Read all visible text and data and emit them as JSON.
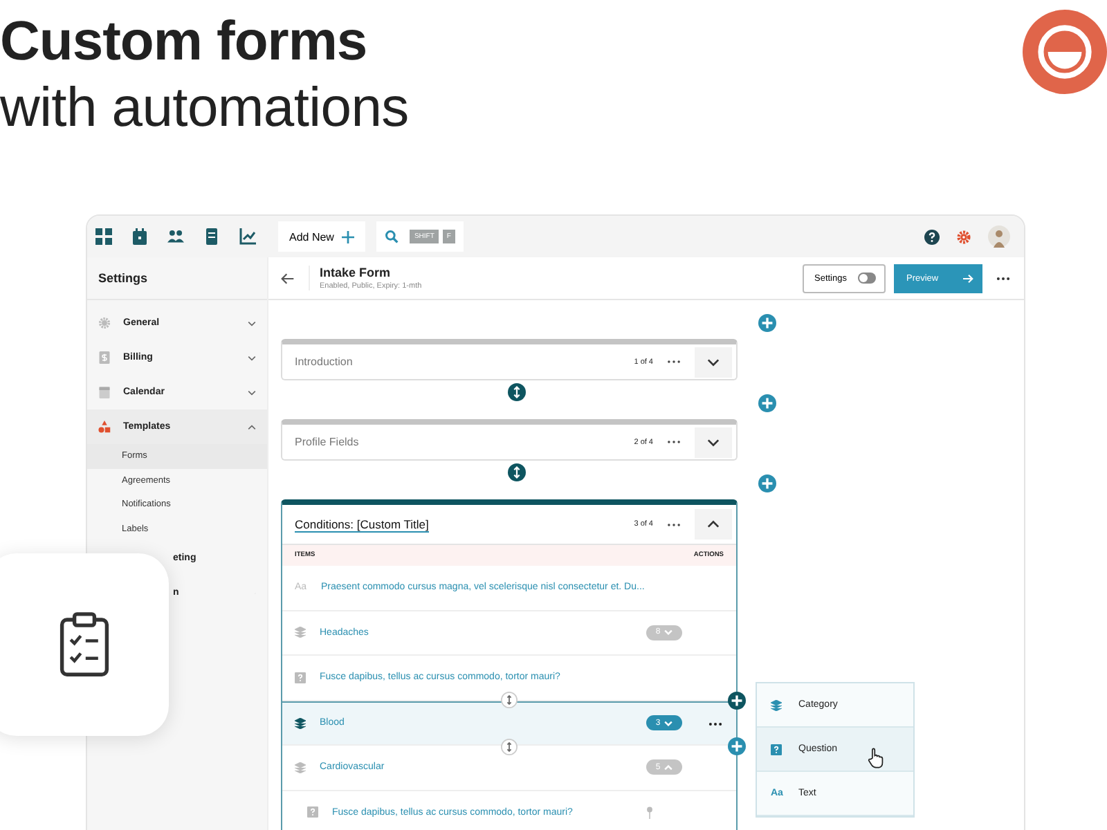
{
  "headline": {
    "title": "Custom forms",
    "subtitle": "with automations"
  },
  "toolbar": {
    "add_new": "Add New",
    "shortcut_keys": [
      "SHIFT",
      "F"
    ]
  },
  "sidebar": {
    "title": "Settings",
    "items": [
      {
        "label": "General",
        "expanded": false,
        "obscured": false
      },
      {
        "label": "Billing",
        "expanded": false,
        "obscured": false
      },
      {
        "label": "Calendar",
        "expanded": false,
        "obscured": false
      },
      {
        "label": "Templates",
        "expanded": true,
        "obscured": false,
        "children": [
          {
            "label": "Forms",
            "selected": true
          },
          {
            "label": "Agreements",
            "selected": false
          },
          {
            "label": "Notifications",
            "selected": false
          },
          {
            "label": "Labels",
            "selected": false
          }
        ]
      },
      {
        "label": "eting",
        "expanded": false,
        "obscured": true
      },
      {
        "label": "n",
        "expanded": false,
        "obscured": true
      }
    ]
  },
  "form": {
    "title": "Intake Form",
    "subtitle": "Enabled, Public, Expiry: 1-mth",
    "settings_toggle": {
      "label": "Settings",
      "on": false
    },
    "preview_button": "Preview"
  },
  "sections": [
    {
      "title": "Introduction",
      "position": "1 of 4",
      "expanded": false
    },
    {
      "title": "Profile Fields",
      "position": "2 of 4",
      "expanded": false
    },
    {
      "title": "Conditions: [Custom Title]",
      "position": "3 of 4",
      "expanded": true,
      "columns": [
        "ITEMS",
        "ACTIONS"
      ],
      "items": [
        {
          "kind": "text",
          "glyph": "Aa",
          "label": "Praesent commodo cursus magna, vel scelerisque nisl consectetur et. Du..."
        },
        {
          "kind": "category",
          "label": "Headaches",
          "count": "8",
          "expanded": false,
          "selected": false
        },
        {
          "kind": "question",
          "label": "Fusce dapibus, tellus ac cursus commodo, tortor mauri?"
        },
        {
          "kind": "category",
          "label": "Blood",
          "count": "3",
          "expanded": false,
          "selected": true
        },
        {
          "kind": "category",
          "label": "Cardiovascular",
          "count": "5",
          "expanded": true,
          "selected": false,
          "children": [
            {
              "kind": "question",
              "label": "Fusce dapibus, tellus ac cursus commodo, tortor mauri?"
            }
          ]
        }
      ]
    }
  ],
  "add_menu": [
    {
      "kind": "category",
      "label": "Category",
      "selected": false
    },
    {
      "kind": "question",
      "label": "Question",
      "selected": true
    },
    {
      "kind": "text",
      "glyph": "Aa",
      "label": "Text",
      "selected": false
    }
  ]
}
